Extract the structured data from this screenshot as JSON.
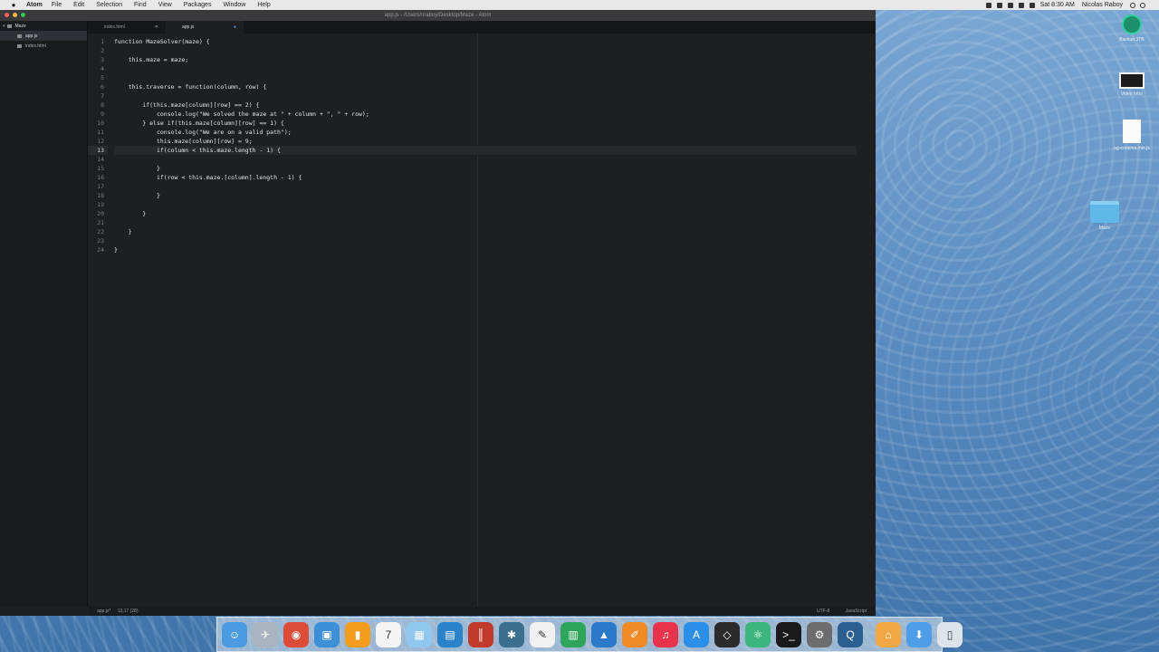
{
  "menubar": {
    "app_name": "Atom",
    "menus": [
      "File",
      "Edit",
      "Selection",
      "Find",
      "View",
      "Packages",
      "Window",
      "Help"
    ],
    "clock": "Sat 8:30 AM",
    "user": "Nicolas Raboy"
  },
  "window": {
    "title": "app.js - /Users/nraboy/Desktop/Maze - Atom"
  },
  "tree": {
    "folder": "Maze",
    "files": [
      "app.js",
      "index.html"
    ],
    "selected": "app.js"
  },
  "tabs": [
    {
      "label": "index.html",
      "active": false,
      "modified": false
    },
    {
      "label": "app.js",
      "active": true,
      "modified": true
    }
  ],
  "editor": {
    "lines": [
      "function MazeSolver(maze) {",
      "",
      "    this.maze = maze;",
      "",
      "",
      "    this.traverse = function(column, row) {",
      "",
      "        if(this.maze[column][row] == 2) {",
      "            console.log(\"We solved the maze at \" + column + \", \" + row);",
      "        } else if(this.maze[column][row] == 1) {",
      "            console.log(\"We are on a valid path\");",
      "            this.maze[column][row] = 9;",
      "            if(column < this.maze.length - 1) {",
      "",
      "            }",
      "            if(row < this.maze.[column].length - 1) {",
      "",
      "            }",
      "",
      "        }",
      "",
      "    }",
      "",
      "}"
    ],
    "cursor_line": 13
  },
  "statusbar": {
    "file": "app.js*",
    "position": "13,17 (28)",
    "encoding": "UTF-8",
    "grammar": "JavaScript"
  },
  "desktop": {
    "icons": [
      {
        "id": "backup",
        "label": "Backup 3TB",
        "icon": "time-machine-drive-icon"
      },
      {
        "id": "video",
        "label": "Video Intro",
        "icon": "terminal-screenshot-icon"
      },
      {
        "id": "cordova",
        "label": "ng-cordova.min.js",
        "icon": "document-icon"
      },
      {
        "id": "folder",
        "label": "Maze",
        "icon": "folder-icon"
      }
    ]
  },
  "dock": {
    "apps": [
      {
        "name": "finder-icon",
        "color": "#4a9be0",
        "glyph": "☺"
      },
      {
        "name": "launchpad-icon",
        "color": "#aab4c0",
        "glyph": "✈"
      },
      {
        "name": "chrome-icon",
        "color": "#dd4b39",
        "glyph": "◉"
      },
      {
        "name": "preview-icon",
        "color": "#3d8fd6",
        "glyph": "▣"
      },
      {
        "name": "ibooks-icon",
        "color": "#f59b1e",
        "glyph": "▮"
      },
      {
        "name": "calendar-icon",
        "color": "#f4f4f4",
        "glyph": "7"
      },
      {
        "name": "photos-icon",
        "color": "#8fc7ef",
        "glyph": "▦"
      },
      {
        "name": "screen-capture-icon",
        "color": "#2a82c9",
        "glyph": "▤"
      },
      {
        "name": "filezilla-icon",
        "color": "#c0392b",
        "glyph": "║"
      },
      {
        "name": "sequel-icon",
        "color": "#3b6f8f",
        "glyph": "✱"
      },
      {
        "name": "textedit-icon",
        "color": "#f0f0f0",
        "glyph": "✎"
      },
      {
        "name": "numbers-icon",
        "color": "#2ea55a",
        "glyph": "▥"
      },
      {
        "name": "keynote-icon",
        "color": "#2a7ac9",
        "glyph": "▲"
      },
      {
        "name": "pages-icon",
        "color": "#f08a24",
        "glyph": "✐"
      },
      {
        "name": "itunes-icon",
        "color": "#e8334d",
        "glyph": "♫"
      },
      {
        "name": "app-store-icon",
        "color": "#2b8fe8",
        "glyph": "A"
      },
      {
        "name": "unity-icon",
        "color": "#2b2b2b",
        "glyph": "◇"
      },
      {
        "name": "atom-icon",
        "color": "#3bb77e",
        "glyph": "⚛"
      },
      {
        "name": "terminal-icon",
        "color": "#1a1a1a",
        "glyph": ">_"
      },
      {
        "name": "system-preferences-icon",
        "color": "#6d6d6d",
        "glyph": "⚙"
      },
      {
        "name": "quicktime-icon",
        "color": "#2a5f8f",
        "glyph": "Q"
      }
    ],
    "right_apps": [
      {
        "name": "home-folder-icon",
        "color": "#f3a846",
        "glyph": "⌂"
      },
      {
        "name": "downloads-icon",
        "color": "#4e9de8",
        "glyph": "⬇"
      },
      {
        "name": "trash-icon",
        "color": "#dde3ea",
        "glyph": "▯"
      }
    ]
  }
}
